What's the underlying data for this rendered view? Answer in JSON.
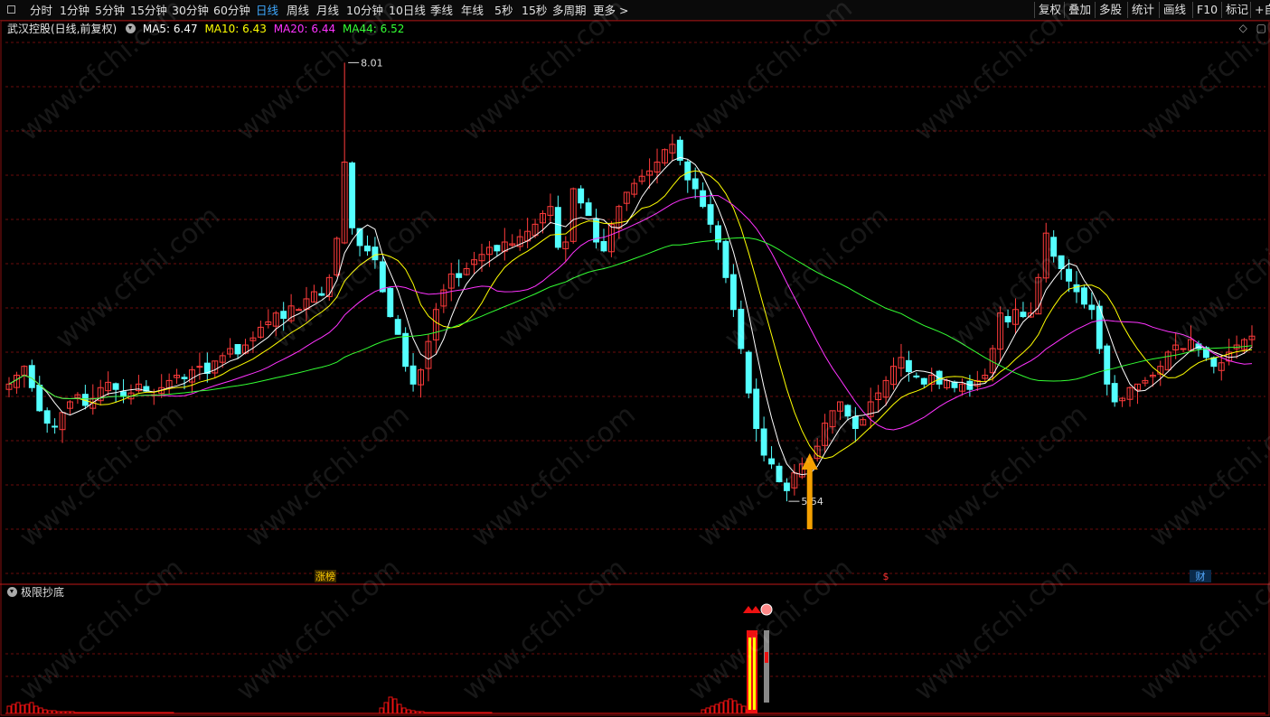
{
  "toolbar": {
    "left_items": [
      "分时",
      "1分钟",
      "5分钟",
      "15分钟",
      "30分钟",
      "60分钟",
      "日线",
      "周线",
      "月线",
      "10分钟",
      "10日线",
      "季线",
      "年线",
      "5秒",
      "15秒",
      "多周期",
      "更多 >"
    ],
    "active": "日线",
    "right_items": [
      "复权",
      "叠加",
      "多股",
      "统计",
      "画线",
      "F10",
      "标记",
      "+自"
    ]
  },
  "legend": {
    "stock": "武汉控股(日线,前复权)",
    "ma": [
      {
        "label": "MA5: 6.47",
        "color": "#ffffff"
      },
      {
        "label": "MA10: 6.43",
        "color": "#ffff00"
      },
      {
        "label": "MA20: 6.44",
        "color": "#ff33ff"
      },
      {
        "label": "MA44: 6.52",
        "color": "#33ff33"
      }
    ]
  },
  "annotations": {
    "high": "8.01",
    "low": "5.54",
    "tags": [
      "涨榜",
      "$",
      "财"
    ]
  },
  "indicator": {
    "title": "极限抄底"
  },
  "watermark": "www.cfchi.com",
  "colors": {
    "up": "#ff3b3b",
    "down": "#54ffff",
    "grid": "#6b0c0c",
    "arrow": "#f5a000",
    "yellow": "#ffff00",
    "red_block": "#ee1111"
  },
  "chart_data": {
    "type": "candlestick",
    "price_range": [
      5.2,
      8.2
    ],
    "high_label": 8.01,
    "low_label": 5.54,
    "ma_current": {
      "MA5": 6.47,
      "MA10": 6.43,
      "MA20": 6.44,
      "MA44": 6.52
    },
    "closes": [
      6.2,
      6.25,
      6.3,
      6.18,
      6.05,
      5.98,
      5.96,
      6.04,
      6.1,
      6.14,
      6.08,
      6.12,
      6.18,
      6.21,
      6.17,
      6.13,
      6.15,
      6.2,
      6.16,
      6.14,
      6.18,
      6.22,
      6.25,
      6.23,
      6.28,
      6.3,
      6.26,
      6.33,
      6.36,
      6.4,
      6.37,
      6.42,
      6.46,
      6.52,
      6.55,
      6.6,
      6.57,
      6.64,
      6.62,
      6.68,
      6.72,
      6.7,
      6.8,
      7.02,
      7.45,
      7.08,
      6.98,
      6.95,
      6.9,
      6.72,
      6.58,
      6.48,
      6.3,
      6.2,
      6.28,
      6.44,
      6.62,
      6.73,
      6.82,
      6.8,
      6.85,
      6.9,
      6.93,
      6.97,
      6.95,
      7.0,
      6.99,
      7.03,
      7.06,
      7.1,
      7.16,
      7.2,
      6.97,
      7.0,
      7.3,
      7.22,
      7.15,
      7.0,
      6.95,
      7.1,
      7.2,
      7.28,
      7.33,
      7.37,
      7.4,
      7.45,
      7.52,
      7.55,
      7.46,
      7.35,
      7.3,
      7.2,
      7.1,
      7.0,
      6.8,
      6.62,
      6.4,
      6.15,
      5.95,
      5.8,
      5.75,
      5.65,
      5.6,
      5.7,
      5.75,
      5.78,
      5.85,
      5.98,
      6.05,
      6.1,
      6.02,
      5.95,
      6.0,
      6.1,
      6.15,
      6.22,
      6.3,
      6.35,
      6.27,
      6.24,
      6.2,
      6.25,
      6.2,
      6.22,
      6.18,
      6.2,
      6.17,
      6.22,
      6.25,
      6.4,
      6.6,
      6.55,
      6.62,
      6.58,
      6.6,
      6.8,
      7.05,
      6.92,
      6.85,
      6.78,
      6.72,
      6.65,
      6.62,
      6.4,
      6.2,
      6.1,
      6.12,
      6.18,
      6.2,
      6.22,
      6.25,
      6.3,
      6.38,
      6.42,
      6.4,
      6.45,
      6.4,
      6.35,
      6.3,
      6.32,
      6.38,
      6.42,
      6.45,
      6.47
    ]
  }
}
